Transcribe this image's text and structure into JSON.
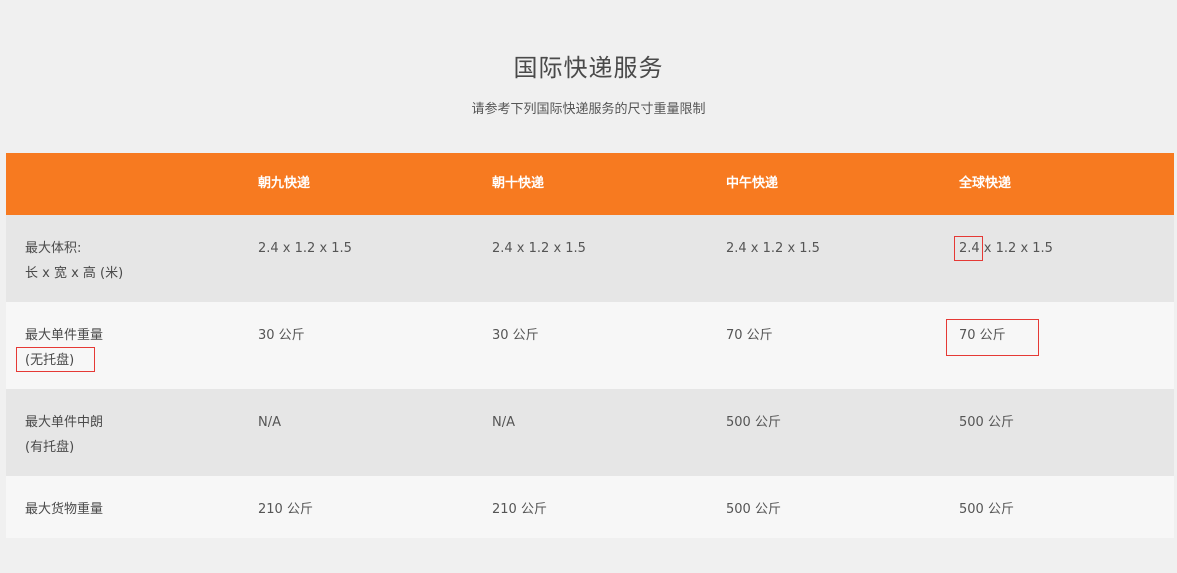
{
  "page": {
    "title": "国际快递服务",
    "subtitle": "请参考下列国际快递服务的尺寸重量限制"
  },
  "table": {
    "headers": [
      "",
      "朝九快递",
      "朝十快递",
      "中午快递",
      "全球快递"
    ],
    "rows": [
      {
        "label_line1": "最大体积:",
        "label_line2": "长 x 宽 x 高 (米)",
        "values": [
          "2.4 x 1.2 x 1.5",
          "2.4 x 1.2 x 1.5",
          "2.4 x 1.2 x 1.5",
          "2.4 x 1.2 x 1.5"
        ]
      },
      {
        "label_line1": "最大单件重量",
        "label_line2": "(无托盘)",
        "values": [
          "30 公斤",
          "30 公斤",
          "70 公斤",
          "70 公斤"
        ]
      },
      {
        "label_line1": "最大单件中朗",
        "label_line2": "(有托盘)",
        "values": [
          "N/A",
          "N/A",
          "500 公斤",
          "500 公斤"
        ]
      },
      {
        "label_line1": "最大货物重量",
        "values": [
          "210 公斤",
          "210 公斤",
          "500 公斤",
          "500 公斤"
        ]
      }
    ]
  },
  "theme": {
    "header_bg": "#f77a20",
    "header_text": "#ffffff",
    "page_bg": "#f0f0f0",
    "row_dark": "#e6e6e6",
    "row_light": "#f7f7f7",
    "highlight_border": "#e53935"
  }
}
